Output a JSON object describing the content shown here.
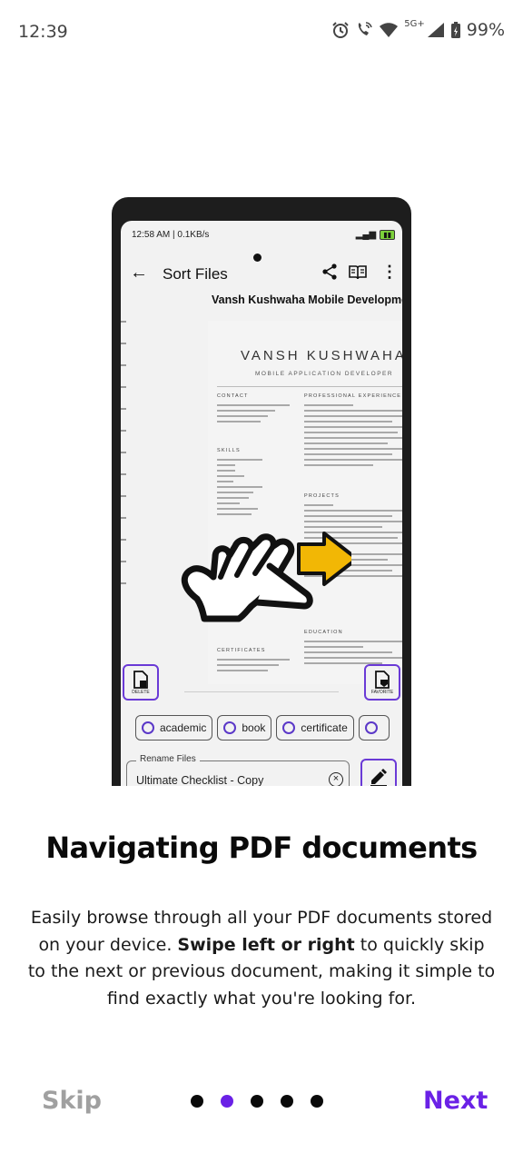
{
  "status_bar": {
    "time": "12:39",
    "network": "5G+",
    "battery": "99%"
  },
  "preview": {
    "status_left": "12:58 AM | 0.1KB/s",
    "appbar_title": "Sort Files",
    "doc_title": "Vansh Kushwaha Mobile Developmen",
    "resume": {
      "name": "VANSH KUSHWAHA",
      "role": "MOBILE APPLICATION DEVELOPER",
      "contact_head": "CONTACT",
      "experience_head": "PROFESSIONAL EXPERIENCE",
      "skills_head": "SKILLS",
      "projects_head": "PROJECTS",
      "education_head": "EDUCATION",
      "certificates_head": "CERTIFICATES"
    },
    "delete_label": "DELETE",
    "favorite_label": "FAVORITE",
    "chips": [
      "academic",
      "book",
      "certificate",
      ""
    ],
    "rename_label": "Rename Files",
    "rename_value": "Ultimate Checklist - Copy"
  },
  "onboarding": {
    "heading": "Navigating PDF documents",
    "body_part1": "Easily browse through all your PDF documents stored on your device. ",
    "body_bold": "Swipe left or right",
    "body_part2": " to quickly skip to the next or previous document, making it simple to find exactly what you're looking for."
  },
  "nav": {
    "skip": "Skip",
    "next": "Next",
    "pages": 5,
    "active_page": 2
  },
  "colors": {
    "accent": "#6a21e6",
    "skip": "#a0a0a0",
    "arrow": "#f2b705"
  },
  "icons": [
    "alarm-icon",
    "wifi-call-icon",
    "wifi-icon",
    "signal-icon",
    "battery-icon",
    "back-arrow-icon",
    "share-icon",
    "book-icon",
    "more-vert-icon",
    "hand-swipe-icon",
    "delete-file-icon",
    "favorite-file-icon",
    "clear-icon",
    "edit-icon"
  ]
}
